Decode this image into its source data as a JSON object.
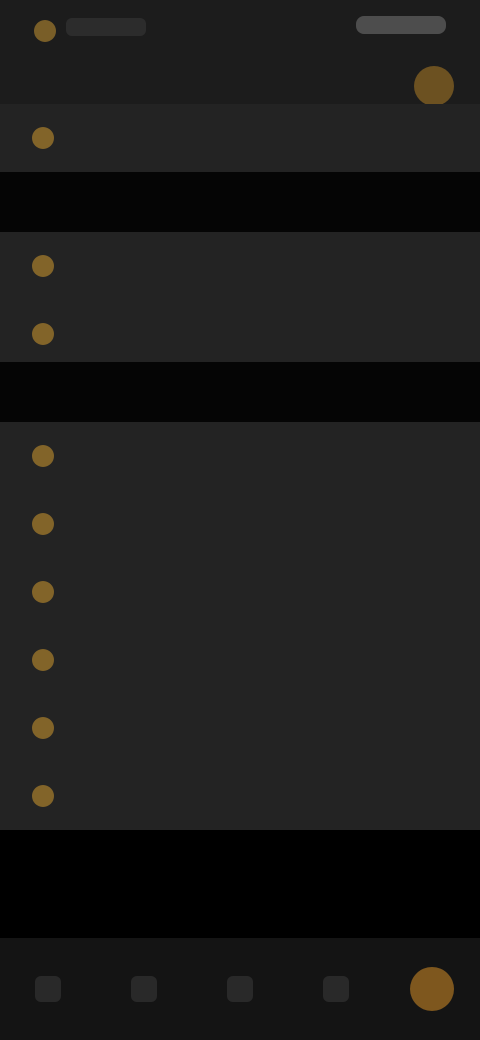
{
  "status_bar": {
    "left_text": "",
    "right_text": ""
  },
  "header": {
    "title": "",
    "action_icon": "orange-circle-icon"
  },
  "rows": [
    {
      "label": "",
      "icon": "settings-icon"
    },
    {
      "label": "",
      "icon": "settings-icon"
    },
    {
      "label": "",
      "icon": "settings-icon"
    }
  ],
  "section_1": {
    "label": ""
  },
  "section_2": {
    "label": ""
  },
  "list": [
    {
      "label": "",
      "icon": "settings-icon"
    },
    {
      "label": "",
      "icon": "settings-icon"
    },
    {
      "label": "",
      "icon": "settings-icon"
    },
    {
      "label": "",
      "icon": "settings-icon"
    },
    {
      "label": "",
      "icon": "settings-icon"
    },
    {
      "label": "",
      "icon": "settings-icon"
    }
  ],
  "bottom_nav": [
    {
      "label": "",
      "icon": "home-icon",
      "active": false
    },
    {
      "label": "",
      "icon": "list-icon",
      "active": false
    },
    {
      "label": "",
      "icon": "center-icon",
      "active": false
    },
    {
      "label": "",
      "icon": "bookmark-icon",
      "active": false
    },
    {
      "label": "",
      "icon": "active-circle-icon",
      "active": true
    }
  ],
  "colors": {
    "background": "#1c1c1c",
    "row_background": "#232323",
    "accent": "#8a5e1f",
    "section_background": "#050505"
  }
}
